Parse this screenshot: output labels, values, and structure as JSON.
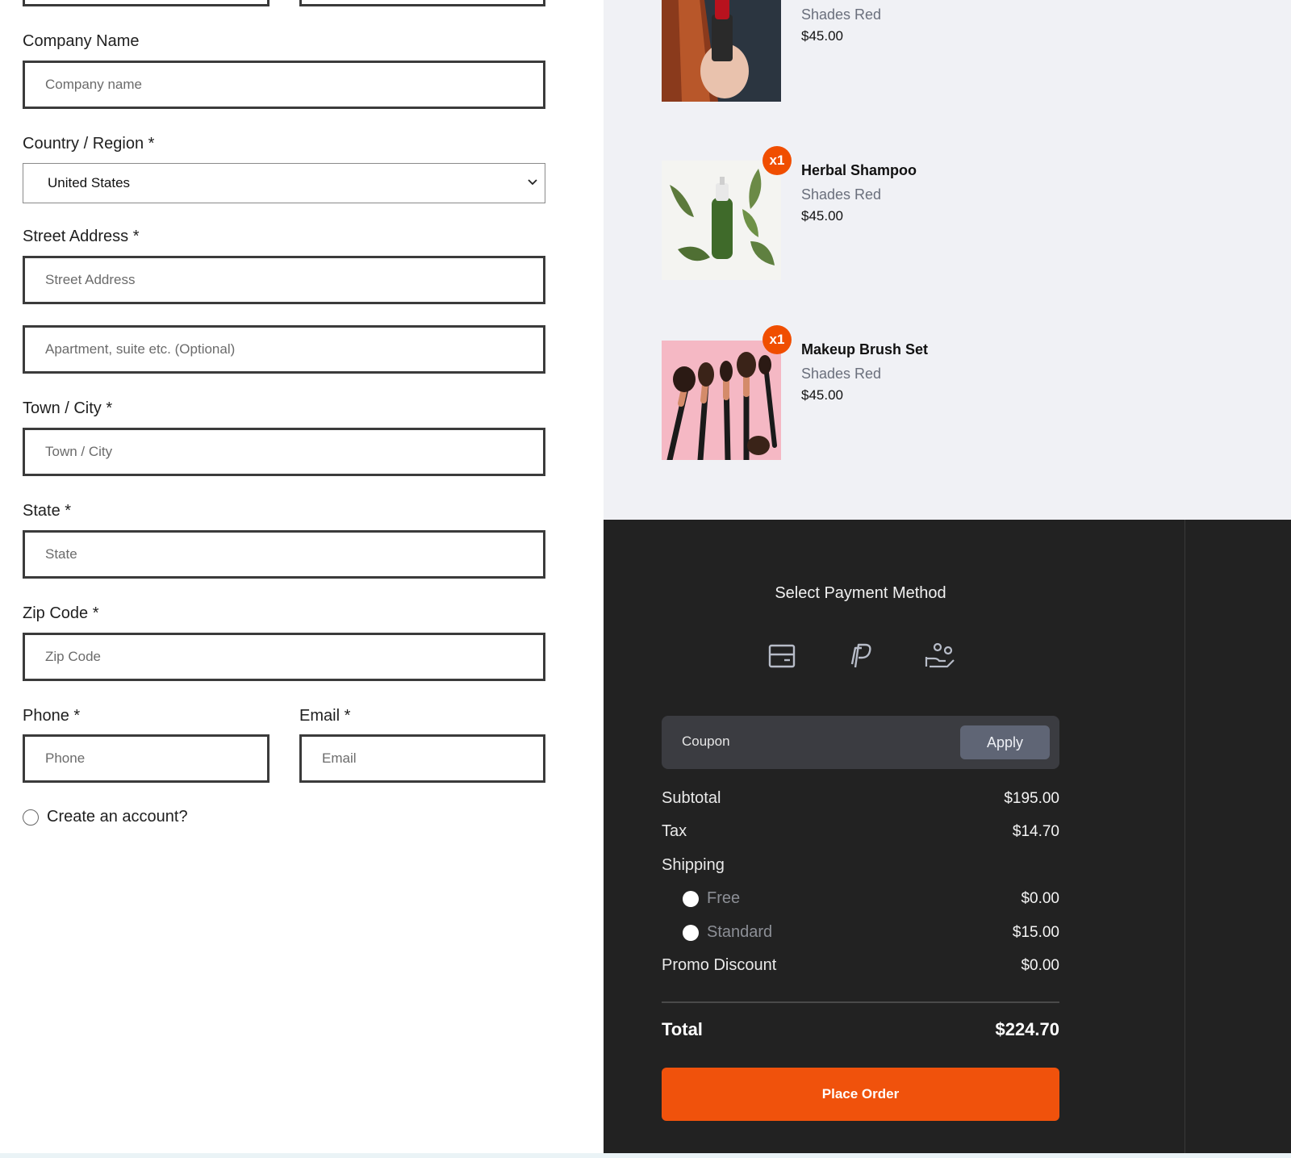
{
  "form": {
    "company": {
      "label": "Company Name",
      "placeholder": "Company name"
    },
    "country": {
      "label": "Country / Region *",
      "value": "United States"
    },
    "street": {
      "label": "Street Address *",
      "placeholder": "Street Address",
      "placeholder2": "Apartment, suite etc. (Optional)"
    },
    "city": {
      "label": "Town / City *",
      "placeholder": "Town / City"
    },
    "state": {
      "label": "State *",
      "placeholder": "State"
    },
    "zip": {
      "label": "Zip Code *",
      "placeholder": "Zip Code"
    },
    "phone": {
      "label": "Phone *",
      "placeholder": "Phone"
    },
    "email": {
      "label": "Email *",
      "placeholder": "Email"
    },
    "create_account": "Create an account?"
  },
  "cart": {
    "items": [
      {
        "name": "",
        "variant": "Shades Red",
        "price": "$45.00"
      },
      {
        "name": "Herbal Shampoo",
        "variant": "Shades Red",
        "price": "$45.00",
        "qty": "x1"
      },
      {
        "name": "Makeup Brush Set",
        "variant": "Shades Red",
        "price": "$45.00",
        "qty": "x1"
      }
    ]
  },
  "payment": {
    "title": "Select Payment Method",
    "icons": [
      "card-icon",
      "paypal-icon",
      "cash-on-delivery-icon"
    ],
    "coupon_placeholder": "Coupon",
    "apply_label": "Apply",
    "subtotal_label": "Subtotal",
    "subtotal": "$195.00",
    "tax_label": "Tax",
    "tax": "$14.70",
    "shipping_label": "Shipping",
    "shipping_options": [
      {
        "label": "Free",
        "price": "$0.00"
      },
      {
        "label": "Standard",
        "price": "$15.00"
      }
    ],
    "promo_label": "Promo Discount",
    "promo": "$0.00",
    "total_label": "Total",
    "total": "$224.70",
    "place_order": "Place Order"
  },
  "colors": {
    "accent": "#f04e00",
    "panel_dark": "#222222",
    "cart_bg": "#f0f1f5"
  }
}
